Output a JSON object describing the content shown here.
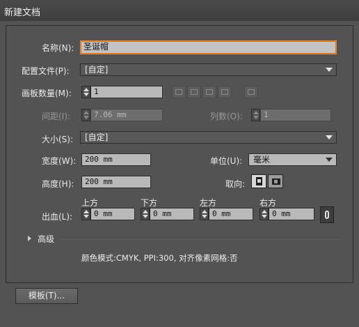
{
  "window": {
    "title": "新建文档"
  },
  "name": {
    "label": "名称(N):",
    "value": "圣诞帽"
  },
  "profile": {
    "label": "配置文件(P):",
    "value": "[自定]"
  },
  "artboards": {
    "label": "画板数量(M):",
    "value": "1"
  },
  "spacing": {
    "label": "间距(I):",
    "value": "7.06 mm"
  },
  "columns": {
    "label": "列数(O):",
    "value": "1"
  },
  "size": {
    "label": "大小(S):",
    "value": "[自定]"
  },
  "width": {
    "label": "宽度(W):",
    "value": "200 mm"
  },
  "units": {
    "label": "单位(U):",
    "value": "毫米"
  },
  "height": {
    "label": "高度(H):",
    "value": "200 mm"
  },
  "orientation": {
    "label": "取向:"
  },
  "bleed": {
    "label": "出血(L):",
    "top": {
      "label": "上方",
      "value": "0 mm"
    },
    "bottom": {
      "label": "下方",
      "value": "0 mm"
    },
    "left": {
      "label": "左方",
      "value": "0 mm"
    },
    "right": {
      "label": "右方",
      "value": "0 mm"
    }
  },
  "advanced": {
    "label": "高级"
  },
  "summary": {
    "text": "颜色模式:CMYK, PPI:300, 对齐像素网格:否"
  },
  "templates_button": {
    "label": "模板(T)..."
  }
}
